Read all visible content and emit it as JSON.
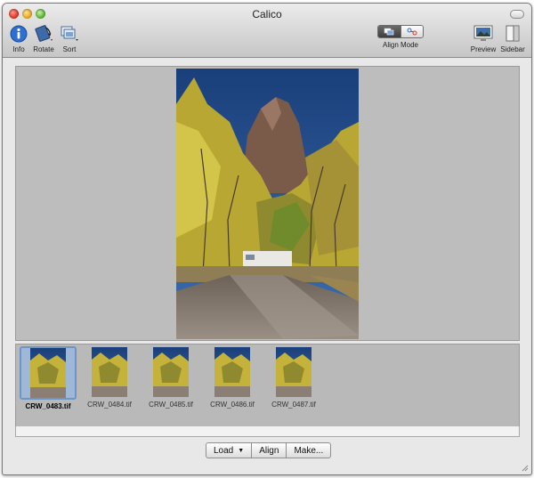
{
  "window": {
    "title": "Calico"
  },
  "toolbar": {
    "info_label": "Info",
    "rotate_label": "Rotate",
    "sort_label": "Sort",
    "align_mode_label": "Align Mode",
    "preview_label": "Preview",
    "sidebar_label": "Sidebar"
  },
  "thumbnails": [
    {
      "name": "CRW_0483.tif",
      "selected": true
    },
    {
      "name": "CRW_0484.tif",
      "selected": false
    },
    {
      "name": "CRW_0485.tif",
      "selected": false
    },
    {
      "name": "CRW_0486.tif",
      "selected": false
    },
    {
      "name": "CRW_0487.tif",
      "selected": false
    }
  ],
  "buttons": {
    "load_label": "Load",
    "align_label": "Align",
    "make_label": "Make..."
  },
  "colors": {
    "sky": "#1f4f8f",
    "foliage": "#c9b93a",
    "cliff": "#7a5a48",
    "road": "#8a7f72",
    "selection": "#6d95c7"
  },
  "icons": {
    "info": "info-icon",
    "rotate": "rotate-icon",
    "sort": "sort-icon",
    "preview": "preview-icon",
    "sidebar": "sidebar-icon"
  }
}
